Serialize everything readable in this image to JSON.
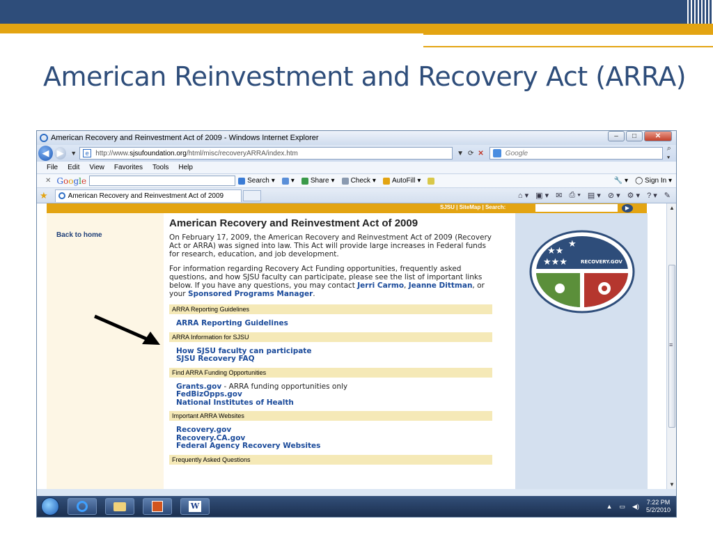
{
  "slide": {
    "title": "American Reinvestment and Recovery Act (ARRA)",
    "colors": {
      "navy": "#2e4d7a",
      "gold": "#e3a412"
    }
  },
  "browser": {
    "window_title": "American Recovery and Reinvestment Act of 2009 - Windows Internet Explorer",
    "address": {
      "prefix": "http://www.",
      "domain": "sjsufoundation.org",
      "path": "/html/misc/recoveryARRA/index.htm"
    },
    "search_placeholder": "Google",
    "menu": [
      "File",
      "Edit",
      "View",
      "Favorites",
      "Tools",
      "Help"
    ],
    "google_toolbar": {
      "logo": [
        "G",
        "o",
        "o",
        "g",
        "l",
        "e"
      ],
      "search_label": "Search",
      "share_label": "Share",
      "check_label": "Check",
      "autofill_label": "AutoFill",
      "sign_in_label": "Sign In"
    },
    "tab_title": "American Recovery and Reinvestment Act of 2009"
  },
  "page": {
    "top_links": "SJSU | SiteMap | Search:",
    "back_link": "Back to home",
    "heading": "American Recovery and Reinvestment Act of 2009",
    "intro": "On February 17, 2009, the American Recovery and Reinvestment Act of 2009 (Recovery Act or ARRA) was signed into law. This Act will provide large increases in Federal funds for research, education, and job development.",
    "info_text": "For information regarding Recovery Act Funding opportunities, frequently asked questions, and how SJSU faculty can participate, please see the list of important links below. If you have any questions, you may contact",
    "contact_1": "Jerri Carmo",
    "contact_sep_1": ",",
    "contact_2": "Jeanne Dittman",
    "contact_sep_2": ", or your",
    "contact_3": "Sponsored Programs Manager",
    "contact_end": ".",
    "sections": [
      {
        "title": "ARRA Reporting Guidelines",
        "links": [
          "ARRA Reporting Guidelines"
        ]
      },
      {
        "title": "ARRA Information for SJSU",
        "links": [
          "How SJSU faculty can participate",
          "SJSU Recovery FAQ"
        ]
      },
      {
        "title": "Find ARRA Funding Opportunities",
        "links": [
          "Grants.gov",
          "FedBizOpps.gov",
          "National Institutes of Health"
        ],
        "note": " - ARRA funding opportunities only"
      },
      {
        "title": "Important ARRA Websites",
        "links": [
          "Recovery.gov",
          "Recovery.CA.gov",
          "Federal Agency Recovery Websites"
        ]
      },
      {
        "title": "Frequently Asked Questions",
        "links": []
      }
    ],
    "seal_text": "RECOVERY.GOV"
  },
  "taskbar": {
    "time": "7:22 PM",
    "date": "5/2/2010",
    "word_icon_letter": "W"
  }
}
